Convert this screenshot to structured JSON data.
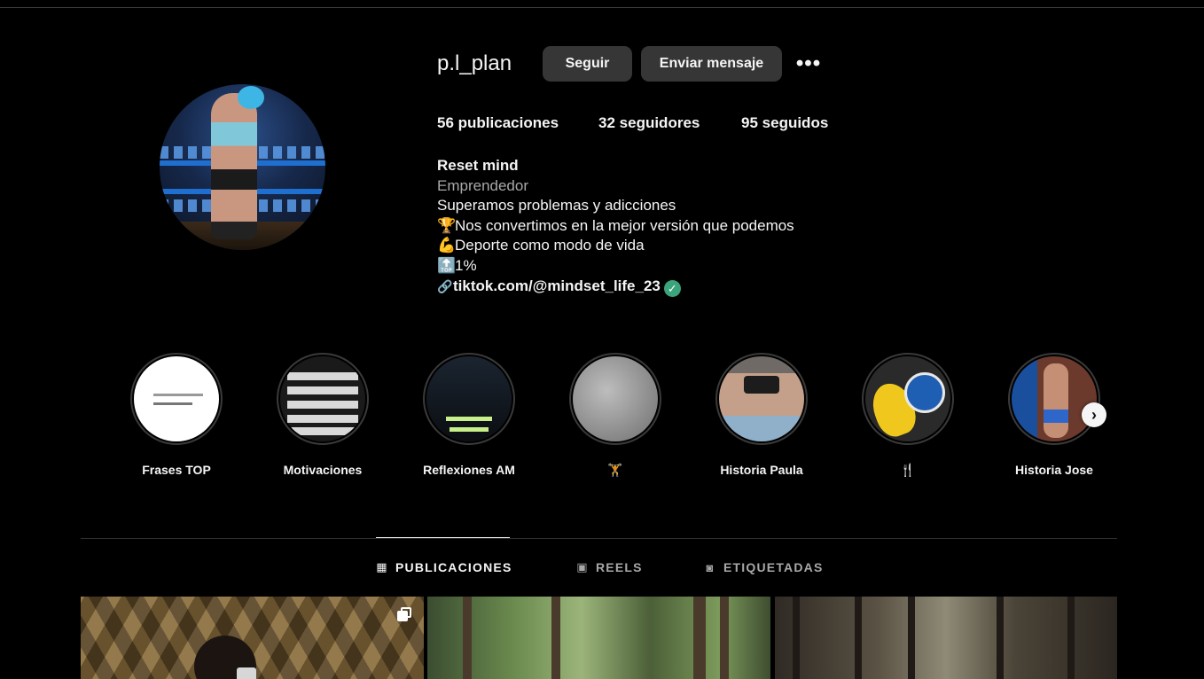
{
  "profile": {
    "username": "p.l_plan",
    "follow_label": "Seguir",
    "message_label": "Enviar mensaje",
    "more_label": "•••",
    "stats": {
      "posts_count": "56",
      "posts_label": "publicaciones",
      "followers_count": "32",
      "followers_label": "seguidores",
      "following_count": "95",
      "following_label": "seguidos"
    },
    "bio": {
      "name": "Reset mind",
      "category": "Emprendedor",
      "lines": [
        {
          "emoji": "",
          "text": "Superamos problemas y adicciones"
        },
        {
          "emoji": "🏆",
          "text": "Nos convertimos en la mejor versión que podemos"
        },
        {
          "emoji": "💪",
          "text": "Deporte como modo de vida"
        },
        {
          "emoji": "🔝",
          "text": "1%"
        }
      ],
      "link_icon": "link-icon",
      "link": "tiktok.com/@mindset_life_23",
      "verified_icon": "check-badge-icon"
    }
  },
  "highlights": [
    {
      "label": "Frases TOP"
    },
    {
      "label": "Motivaciones"
    },
    {
      "label": "Reflexiones AM"
    },
    {
      "label": "🏋"
    },
    {
      "label": "Historia Paula"
    },
    {
      "label": "🍴"
    },
    {
      "label": "Historia Jose"
    }
  ],
  "highlights_next_icon": "chevron-right-icon",
  "tabs": [
    {
      "label": "PUBLICACIONES",
      "icon": "grid-icon",
      "active": true
    },
    {
      "label": "REELS",
      "icon": "reels-icon",
      "active": false
    },
    {
      "label": "ETIQUETADAS",
      "icon": "tagged-icon",
      "active": false
    }
  ],
  "colors": {
    "background": "#000000",
    "button": "#363636",
    "muted_text": "#a8a8a8",
    "verified": "#3aa47d"
  }
}
